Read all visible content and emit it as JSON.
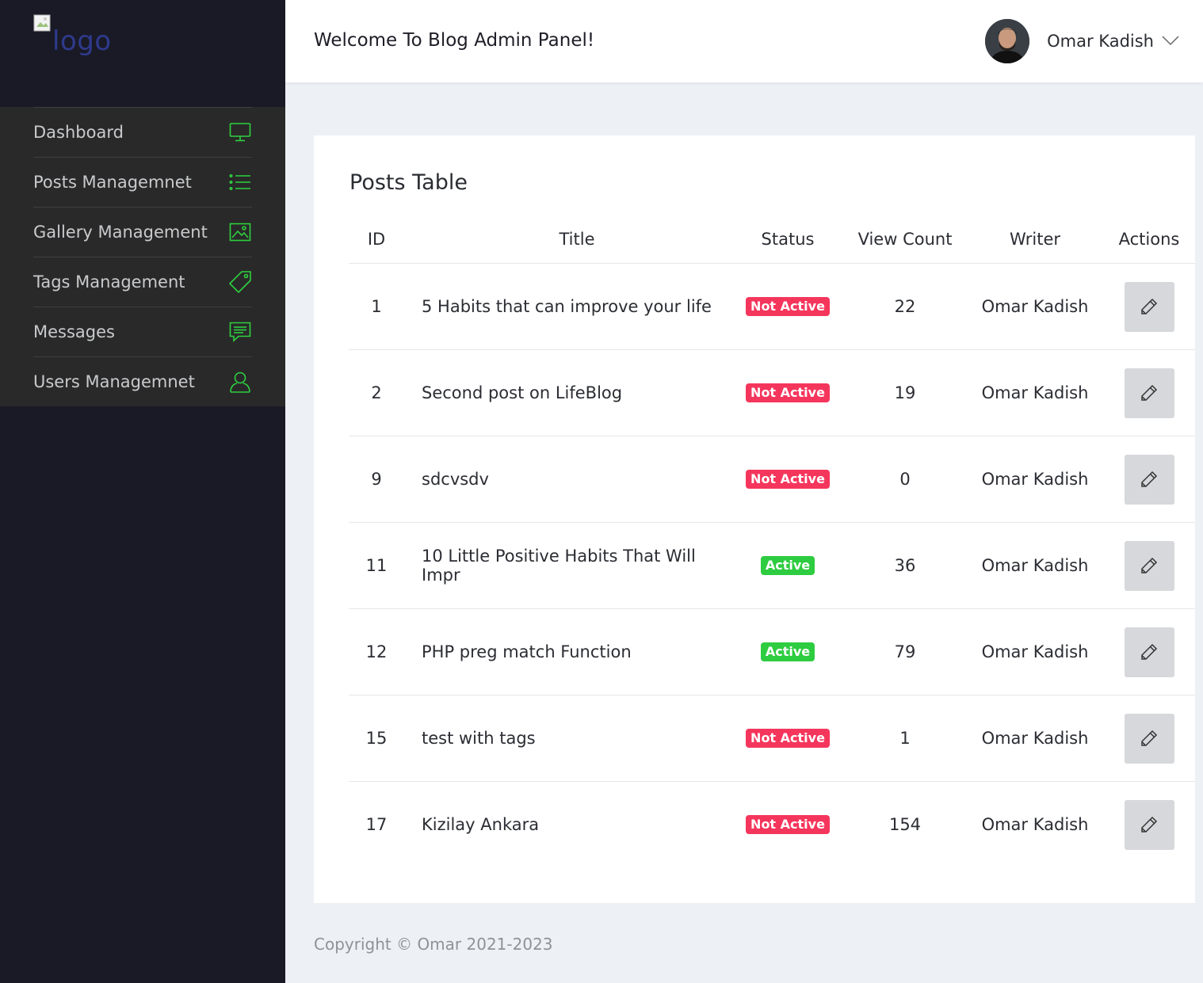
{
  "sidebar": {
    "logo_alt": "logo",
    "items": [
      {
        "label": "Dashboard",
        "icon": "monitor-icon"
      },
      {
        "label": "Posts Managemnet",
        "icon": "list-icon"
      },
      {
        "label": "Gallery Management",
        "icon": "image-icon"
      },
      {
        "label": "Tags Management",
        "icon": "tag-icon"
      },
      {
        "label": "Messages",
        "icon": "message-icon"
      },
      {
        "label": "Users Managemnet",
        "icon": "user-icon"
      }
    ],
    "accent_color": "#2ed13f"
  },
  "header": {
    "welcome": "Welcome To Blog Admin Panel!",
    "user_name": "Omar Kadish"
  },
  "posts_table": {
    "title": "Posts Table",
    "columns": [
      "ID",
      "Title",
      "Status",
      "View Count",
      "Writer",
      "Actions"
    ],
    "rows": [
      {
        "id": "1",
        "title": "5 Habits that can improve your life",
        "status": "Not Active",
        "views": "22",
        "writer": "Omar Kadish"
      },
      {
        "id": "2",
        "title": "Second post on LifeBlog",
        "status": "Not Active",
        "views": "19",
        "writer": "Omar Kadish"
      },
      {
        "id": "9",
        "title": "sdcvsdv",
        "status": "Not Active",
        "views": "0",
        "writer": "Omar Kadish"
      },
      {
        "id": "11",
        "title": "10 Little Positive Habits That Will Impr",
        "status": "Active",
        "views": "36",
        "writer": "Omar Kadish"
      },
      {
        "id": "12",
        "title": "PHP preg match Function",
        "status": "Active",
        "views": "79",
        "writer": "Omar Kadish"
      },
      {
        "id": "15",
        "title": "test with tags",
        "status": "Not Active",
        "views": "1",
        "writer": "Omar Kadish"
      },
      {
        "id": "17",
        "title": "Kizilay Ankara",
        "status": "Not Active",
        "views": "154",
        "writer": "Omar Kadish"
      }
    ],
    "status_colors": {
      "Active": "#2ecc40",
      "Not Active": "#f5365c"
    }
  },
  "footer": {
    "copyright": "Copyright © Omar 2021-2023"
  }
}
